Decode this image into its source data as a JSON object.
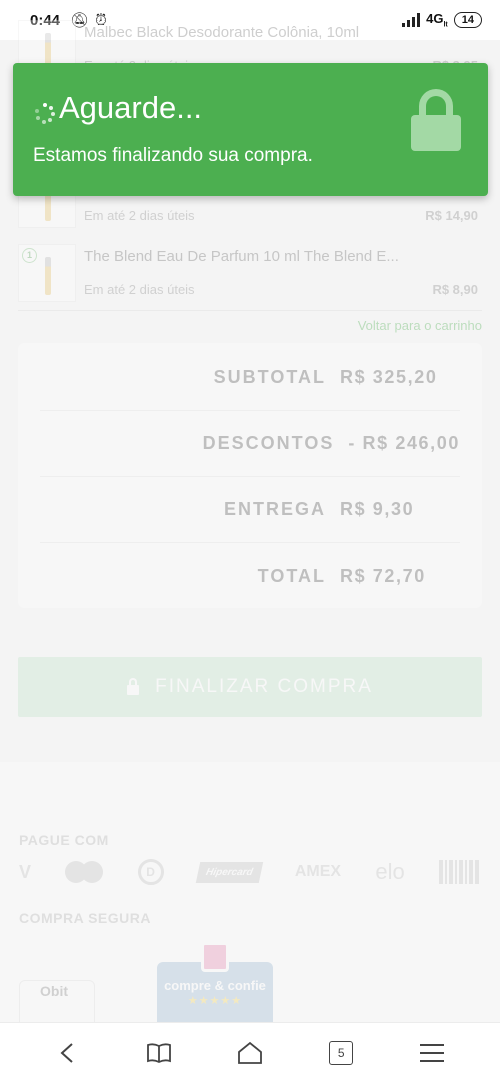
{
  "status_bar": {
    "time": "0:44",
    "network": "4G",
    "network_sub": "lt",
    "battery": "14"
  },
  "cart": {
    "items": [
      {
        "name": "Malbec Black Desodorante Colônia, 10ml",
        "delivery": "Em até 2 dias úteis",
        "price": "R$ 3,95",
        "qty": ""
      },
      {
        "name": "",
        "delivery": "Em até 2 dias úteis",
        "price": "R$ 14,90",
        "qty": ""
      },
      {
        "name": "The Blend Eau De Parfum 10 ml The Blend E...",
        "delivery": "Em até 2 dias úteis",
        "price": "R$ 8,90",
        "qty": "1"
      }
    ],
    "back_link": "Voltar para o carrinho"
  },
  "totals": {
    "subtotal_label": "SUBTOTAL",
    "subtotal_value": "R$ 325,20",
    "discounts_label": "DESCONTOS",
    "discounts_value": "- R$ 246,00",
    "delivery_label": "ENTREGA",
    "delivery_value": "R$ 9,30",
    "total_label": "TOTAL",
    "total_value": "R$ 72,70"
  },
  "finalize_button": {
    "label": "FINALIZAR COMPRA"
  },
  "footer": {
    "pay_title": "PAGUE COM",
    "payment_methods": [
      "V",
      "",
      "D",
      "Hipercard",
      "AMEX",
      "elo",
      ""
    ],
    "secure_title": "COMPRA SEGURA",
    "badge_obit": "Obit",
    "badge_cc": "compre & confie",
    "badge_cc_stars": "★★★★★"
  },
  "nav": {
    "tab_count": "5"
  },
  "toast": {
    "title": "Aguarde...",
    "message": "Estamos finalizando sua compra.",
    "color": "#4caf50"
  }
}
